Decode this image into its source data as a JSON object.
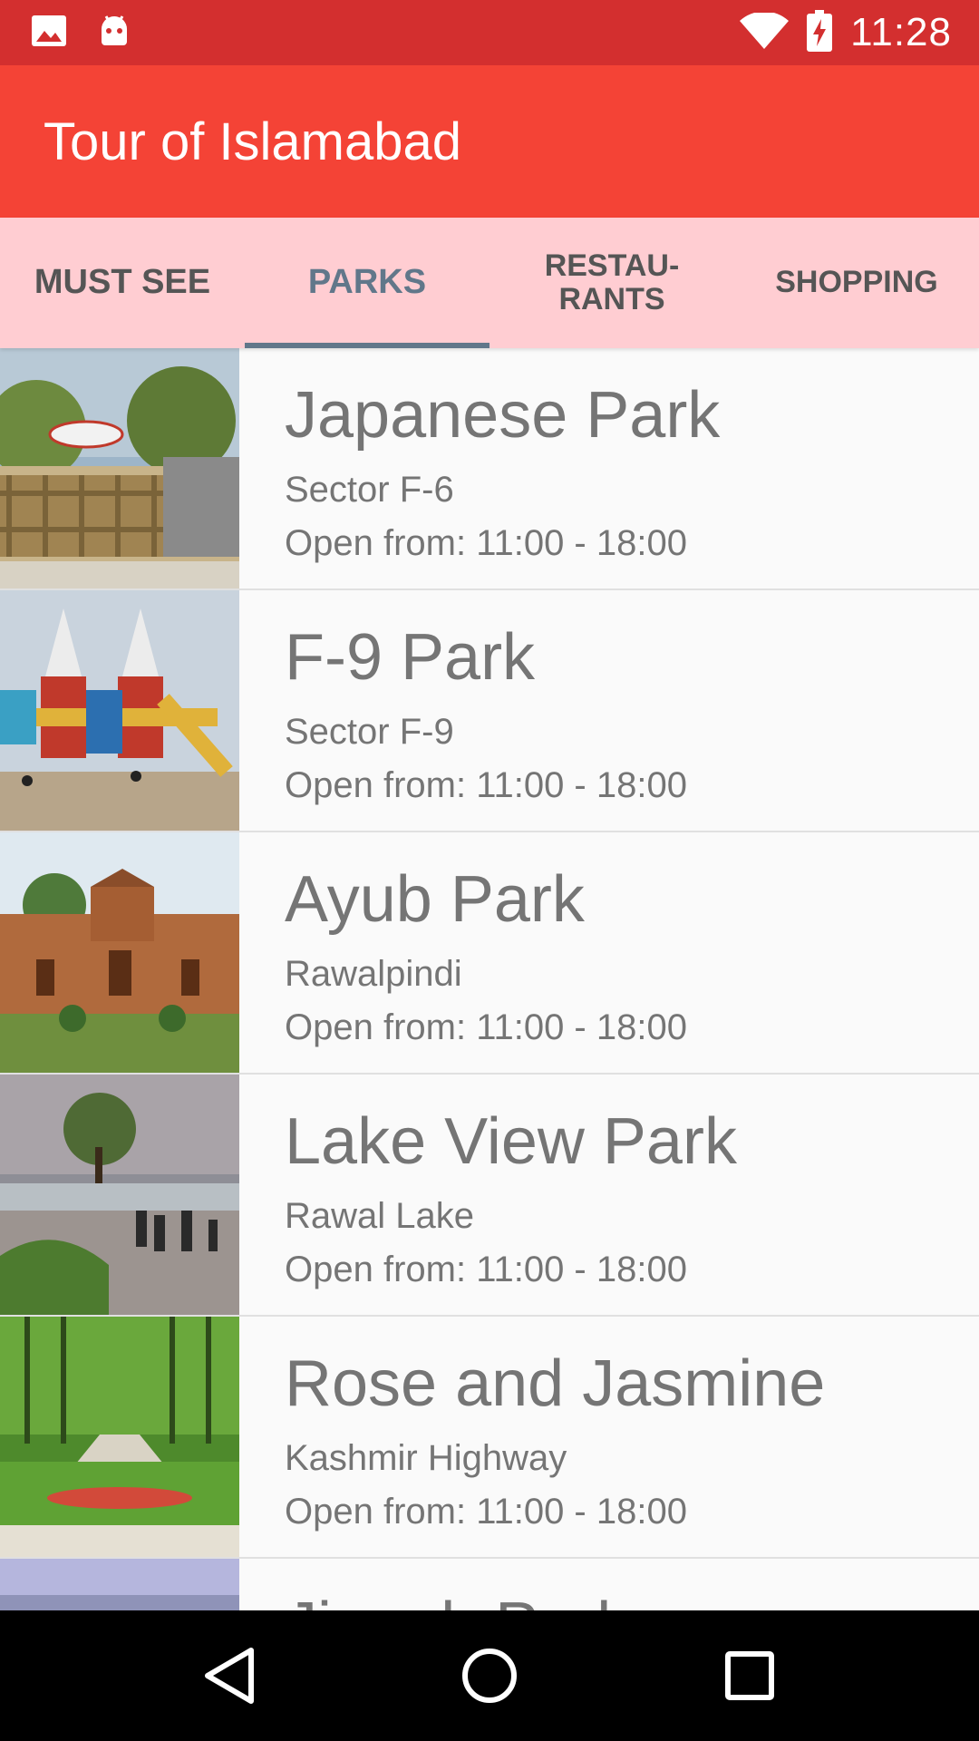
{
  "status_bar": {
    "time": "11:28",
    "icons": [
      "image-icon",
      "android-icon",
      "wifi-icon",
      "battery-charging-icon"
    ]
  },
  "app_bar": {
    "title": "Tour of Islamabad"
  },
  "tabs": [
    {
      "label": "MUST SEE",
      "active": false
    },
    {
      "label": "PARKS",
      "active": true
    },
    {
      "label": "RESTAU-\nRANTS",
      "active": false
    },
    {
      "label": "SHOPPING",
      "active": false
    }
  ],
  "places": [
    {
      "name": "Japanese Park",
      "location": "Sector F-6",
      "hours": "Open from: 11:00 - 18:00"
    },
    {
      "name": "F-9 Park",
      "location": "Sector F-9",
      "hours": "Open from: 11:00 - 18:00"
    },
    {
      "name": "Ayub Park",
      "location": "Rawalpindi",
      "hours": "Open from: 11:00 - 18:00"
    },
    {
      "name": "Lake View Park",
      "location": "Rawal Lake",
      "hours": "Open from: 11:00 - 18:00"
    },
    {
      "name": "Rose and Jasmine",
      "location": "Kashmir Highway",
      "hours": "Open from: 11:00 - 18:00"
    },
    {
      "name": "Jinnah Park",
      "location": "",
      "hours": ""
    }
  ],
  "nav_bar": {
    "buttons": [
      "back-icon",
      "home-icon",
      "recents-icon"
    ]
  },
  "colors": {
    "status_bar": "#d32f2f",
    "app_bar": "#f44336",
    "tab_bar": "#ffcdd2",
    "tab_active": "#61778a"
  }
}
